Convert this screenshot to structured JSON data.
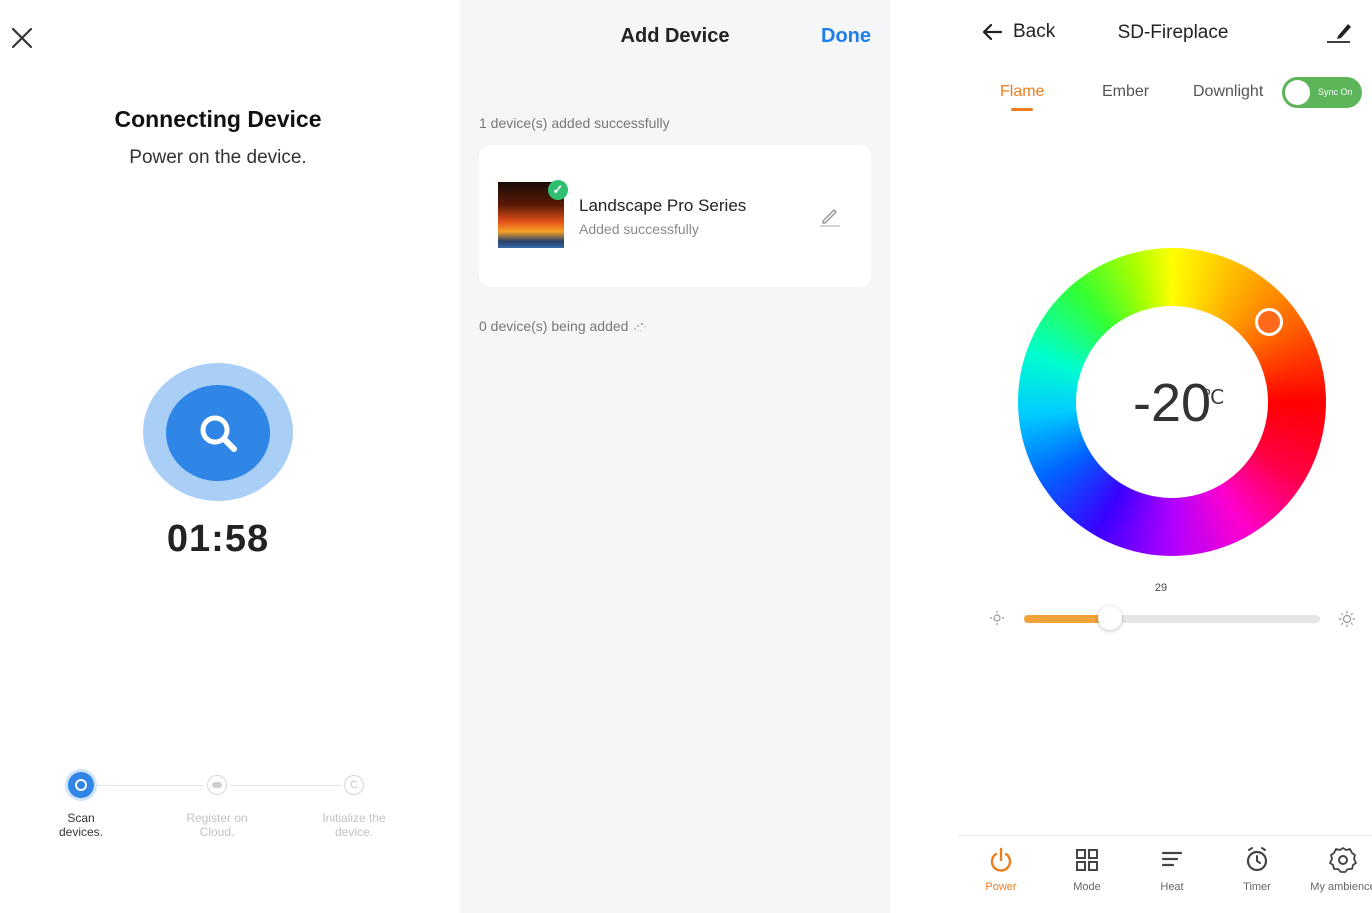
{
  "connecting": {
    "title": "Connecting Device",
    "subtitle": "Power on the device.",
    "countdown": "01:58",
    "steps": [
      {
        "label_line1": "Scan",
        "label_line2": "devices.",
        "state": "active"
      },
      {
        "label_line1": "Register on",
        "label_line2": "Cloud.",
        "state": "pending"
      },
      {
        "label_line1": "Initialize the",
        "label_line2": "device.",
        "state": "pending"
      }
    ],
    "accent_color": "#2f86e6"
  },
  "add_device": {
    "title": "Add Device",
    "done_label": "Done",
    "added_summary": "1 device(s) added successfully",
    "device": {
      "name": "Landscape Pro Series",
      "status": "Added successfully"
    },
    "pending_summary": "0 device(s) being added"
  },
  "fireplace": {
    "back_label": "Back",
    "device_title": "SD-Fireplace",
    "tabs": [
      {
        "label": "Flame",
        "active": true
      },
      {
        "label": "Ember",
        "active": false
      },
      {
        "label": "Downlight",
        "active": false
      }
    ],
    "sync_label": "Sync On",
    "temperature": "-20",
    "temperature_unit": "℃",
    "brightness_value": "29",
    "brightness_fraction": 0.29,
    "hue_handle_color": "#ff6a1a",
    "accent_color": "#ee7d1f",
    "bottom_nav": [
      {
        "label": "Power",
        "icon": "power-icon",
        "active": true
      },
      {
        "label": "Mode",
        "icon": "mode-grid-icon",
        "active": false
      },
      {
        "label": "Heat",
        "icon": "heat-icon",
        "active": false
      },
      {
        "label": "Timer",
        "icon": "timer-icon",
        "active": false
      },
      {
        "label": "My ambience",
        "icon": "gear-icon",
        "active": false
      }
    ]
  }
}
